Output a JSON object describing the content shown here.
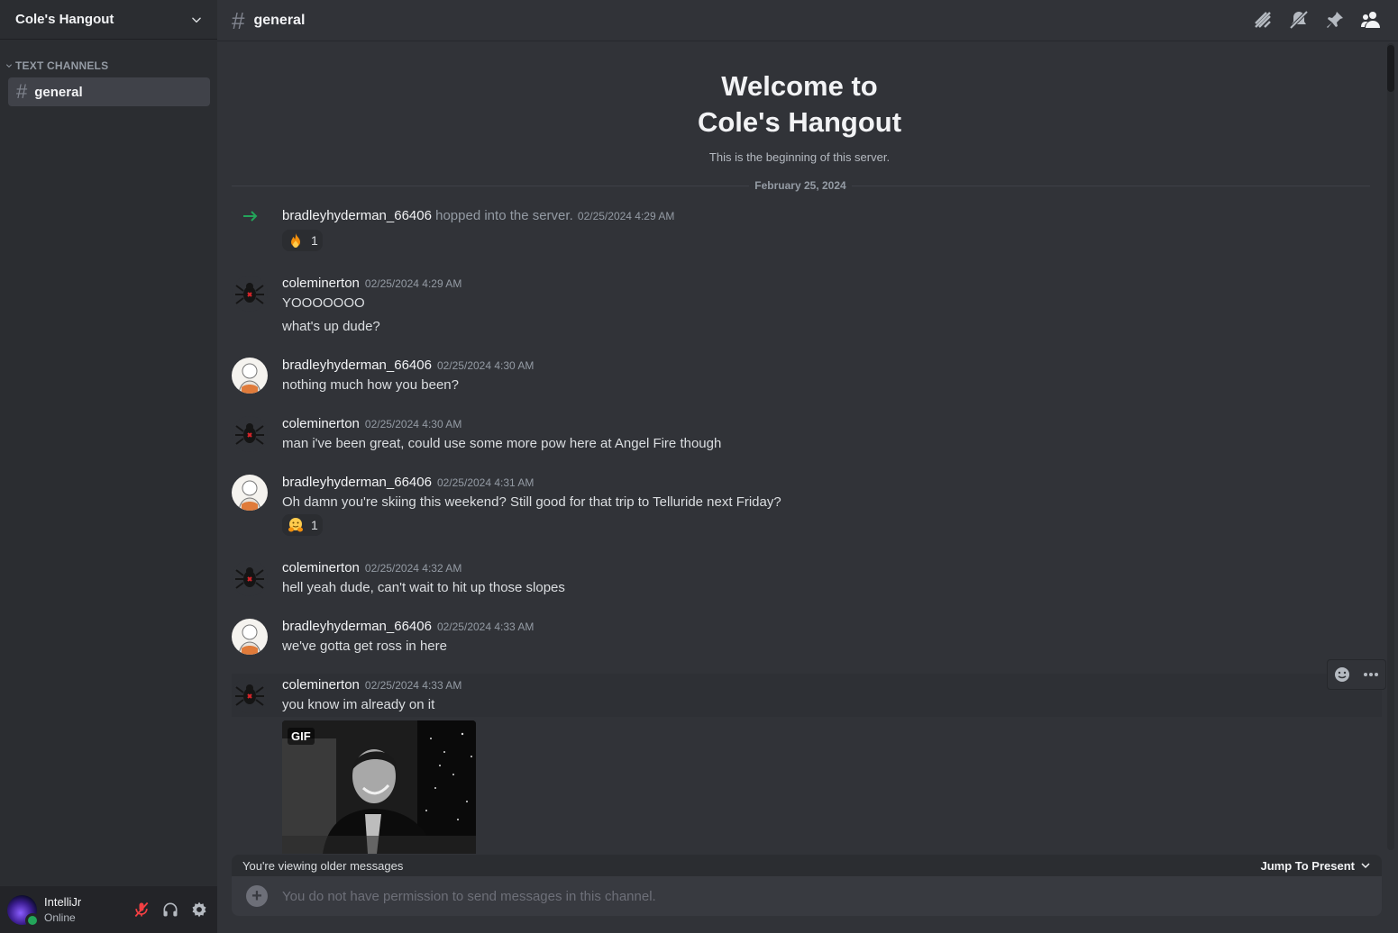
{
  "server": {
    "name": "Cole's Hangout"
  },
  "sidebar": {
    "category": "TEXT CHANNELS",
    "channels": [
      {
        "label": "general"
      }
    ]
  },
  "user": {
    "name": "IntelliJr",
    "status": "Online"
  },
  "channel": {
    "hash": "#",
    "name": "general"
  },
  "welcome": {
    "line1": "Welcome to",
    "line2": "Cole's Hangout",
    "subtitle": "This is the beginning of this server."
  },
  "date_divider": "February 25, 2024",
  "messages": [
    {
      "type": "system",
      "user": "bradleyhyderman_66406",
      "text": "hopped into the server.",
      "time": "02/25/2024 4:29 AM",
      "reaction": {
        "emoji": "fire",
        "count": "1"
      }
    },
    {
      "user": "coleminerton",
      "time": "02/25/2024 4:29 AM",
      "lines": [
        "YOOOOOOO",
        "what's up dude?"
      ]
    },
    {
      "user": "bradleyhyderman_66406",
      "time": "02/25/2024 4:30 AM",
      "lines": [
        "nothing much how you been?"
      ]
    },
    {
      "user": "coleminerton",
      "time": "02/25/2024 4:30 AM",
      "lines": [
        "man i've been great, could use some more pow here at Angel Fire though"
      ]
    },
    {
      "user": "bradleyhyderman_66406",
      "time": "02/25/2024 4:31 AM",
      "lines": [
        "Oh damn you're skiing this weekend? Still good for that trip to Telluride next Friday?"
      ],
      "reaction": {
        "emoji": "hugging-face",
        "count": "1"
      }
    },
    {
      "user": "coleminerton",
      "time": "02/25/2024 4:32 AM",
      "lines": [
        "hell yeah dude, can't wait to hit up those slopes"
      ]
    },
    {
      "user": "bradleyhyderman_66406",
      "time": "02/25/2024 4:33 AM",
      "lines": [
        "we've gotta get ross in here"
      ]
    },
    {
      "user": "coleminerton",
      "time": "02/25/2024 4:33 AM",
      "lines": [
        "you know im already on it"
      ],
      "attachment": {
        "badge": "GIF"
      }
    }
  ],
  "older_bar": {
    "text": "You're viewing older messages",
    "jump": "Jump To Present"
  },
  "composer": {
    "placeholder": "You do not have permission to send messages in this channel."
  },
  "colors": {
    "accent_green": "#23a55a",
    "muted_red": "#f23f42"
  }
}
